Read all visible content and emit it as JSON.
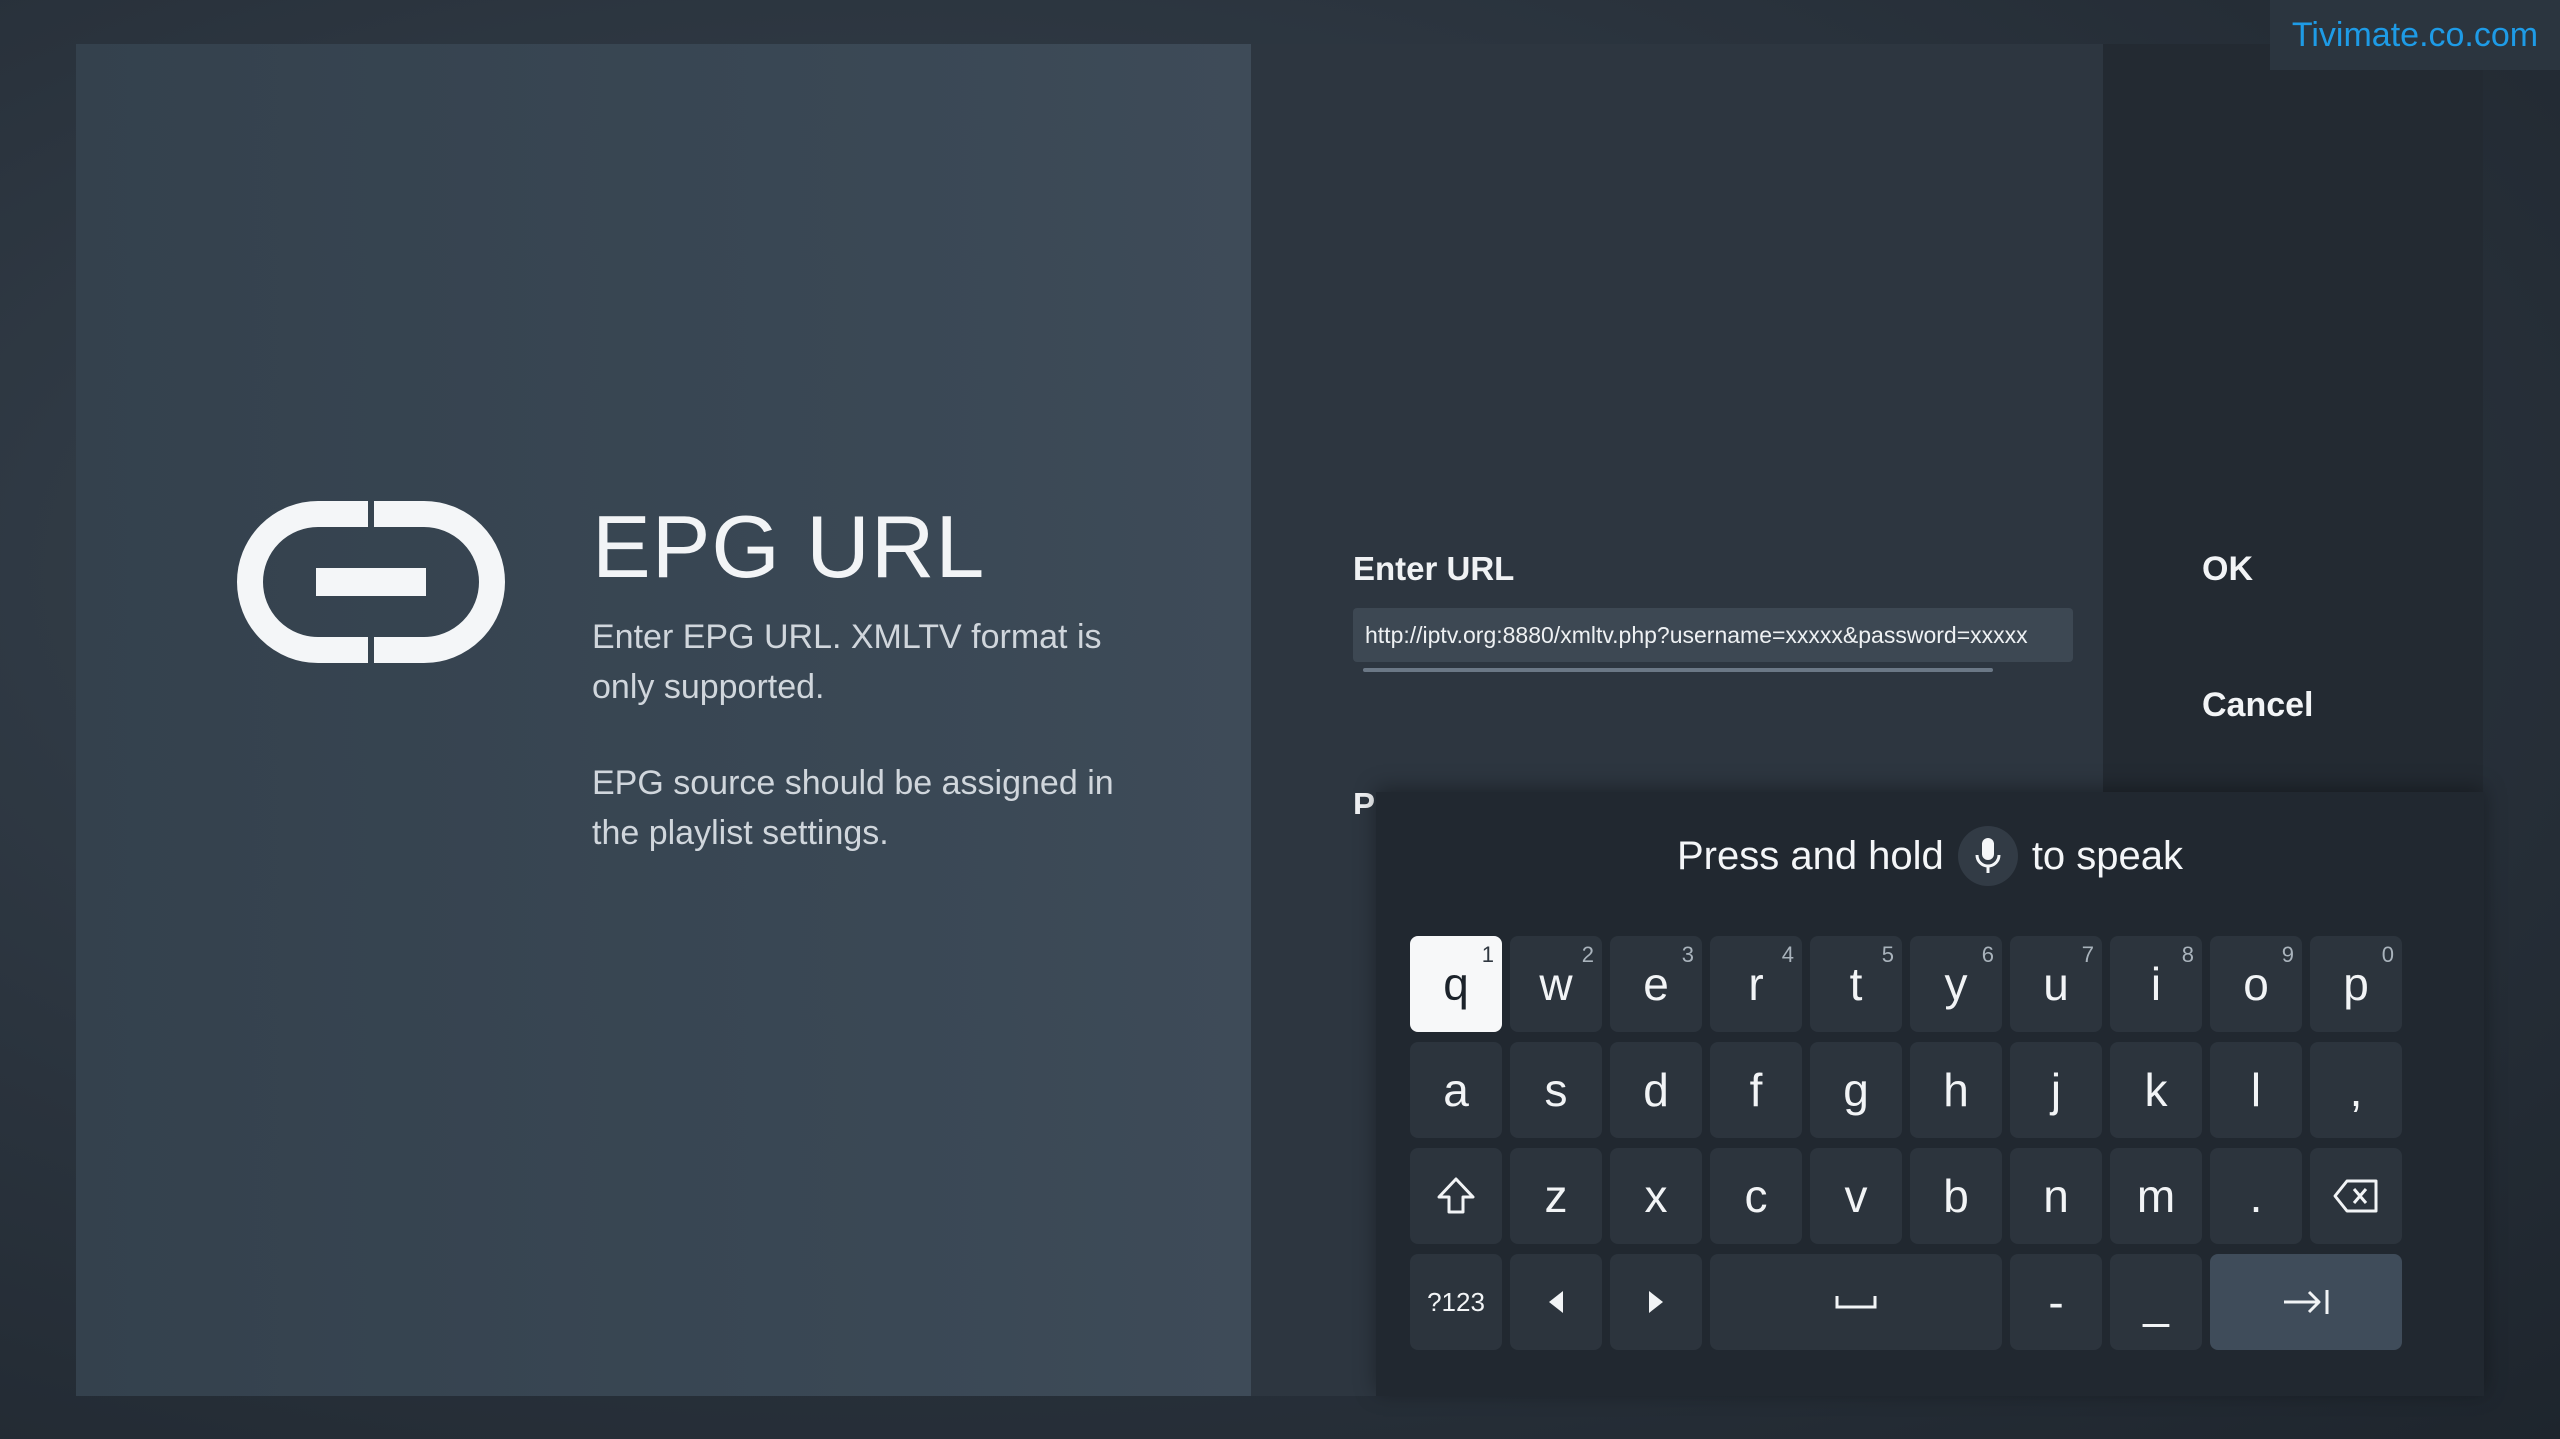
{
  "watermark": "Tivimate.co.com",
  "info": {
    "icon": "link-icon",
    "title": "EPG URL",
    "description_1": "Enter EPG URL. XMLTV format is only supported.",
    "description_2": "EPG source should be assigned in the playlist settings."
  },
  "dialog": {
    "field_label": "Enter URL",
    "url_value": "http://iptv.org:8880/xmltv.php?username=xxxxx&password=xxxxx",
    "partial_label": "P"
  },
  "actions": {
    "ok": "OK",
    "cancel": "Cancel"
  },
  "keyboard": {
    "voice_hint_before": "Press and hold",
    "voice_hint_after": "to speak",
    "mic_icon": "mic-icon",
    "row1": [
      {
        "label": "q",
        "hint": "1"
      },
      {
        "label": "w",
        "hint": "2"
      },
      {
        "label": "e",
        "hint": "3"
      },
      {
        "label": "r",
        "hint": "4"
      },
      {
        "label": "t",
        "hint": "5"
      },
      {
        "label": "y",
        "hint": "6"
      },
      {
        "label": "u",
        "hint": "7"
      },
      {
        "label": "i",
        "hint": "8"
      },
      {
        "label": "o",
        "hint": "9"
      },
      {
        "label": "p",
        "hint": "0"
      }
    ],
    "row2": [
      "a",
      "s",
      "d",
      "f",
      "g",
      "h",
      "j",
      "k",
      "l",
      ","
    ],
    "row3": [
      "z",
      "x",
      "c",
      "v",
      "b",
      "n",
      "m",
      "."
    ],
    "row4": {
      "symbols": "?123",
      "dash": "-",
      "underscore": "_"
    },
    "focused_key": "q"
  },
  "colors": {
    "accent_watermark": "#1e9be6",
    "key_bg": "#2c343d",
    "key_focused_bg": "#f7f8f9"
  }
}
